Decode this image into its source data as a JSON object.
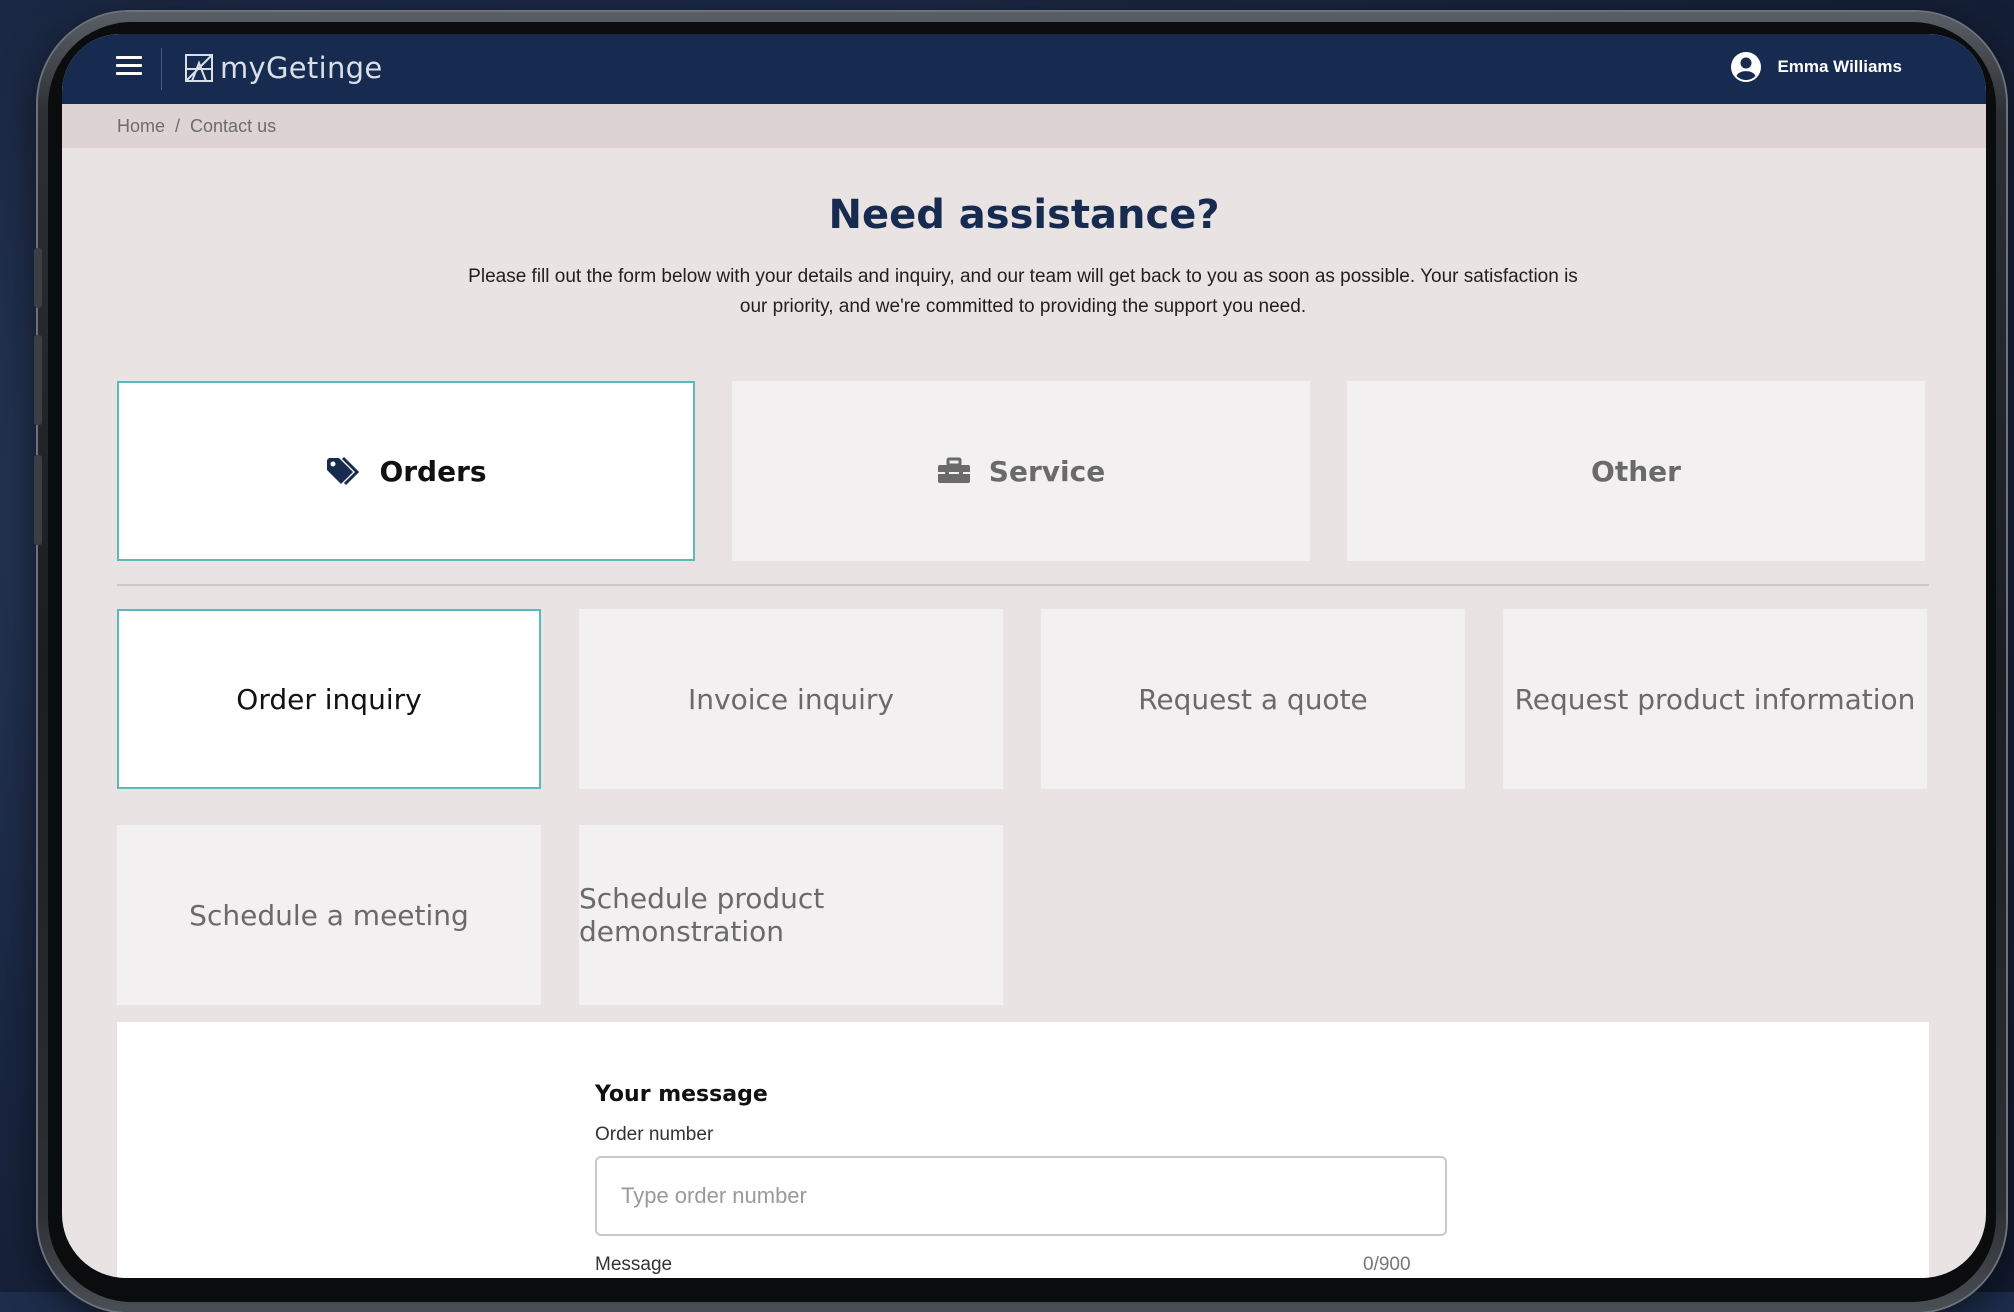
{
  "header": {
    "app_name": "myGetinge",
    "user_name": "Emma Williams",
    "colors": {
      "bar": "#162b4f",
      "accent": "#5ab9bd"
    },
    "icons": {
      "menu": "hamburger-menu-icon",
      "logo": "getinge-logo-icon",
      "user": "user-avatar-icon"
    }
  },
  "breadcrumb": {
    "home": "Home",
    "separator": "/",
    "current": "Contact us"
  },
  "hero": {
    "title": "Need assistance?",
    "description": "Please fill out the form below with your details and inquiry, and our team will get back to you as soon as possible. Your satisfaction is our priority, and we're committed to providing the support you need."
  },
  "categories": [
    {
      "label": "Orders",
      "icon": "tag-icon",
      "selected": true
    },
    {
      "label": "Service",
      "icon": "toolbox-icon",
      "selected": false
    },
    {
      "label": "Other",
      "icon": "",
      "selected": false
    }
  ],
  "subcategories": [
    {
      "label": "Order inquiry",
      "selected": true
    },
    {
      "label": "Invoice inquiry",
      "selected": false
    },
    {
      "label": "Request a quote",
      "selected": false
    },
    {
      "label": "Request product information",
      "selected": false
    },
    {
      "label": "Schedule a meeting",
      "selected": false
    },
    {
      "label": "Schedule product demonstration",
      "selected": false
    }
  ],
  "form": {
    "heading": "Your message",
    "order_number_label": "Order number",
    "order_number_placeholder": "Type order number",
    "order_number_value": "",
    "message_label": "Message",
    "message_counter": "0/900"
  }
}
